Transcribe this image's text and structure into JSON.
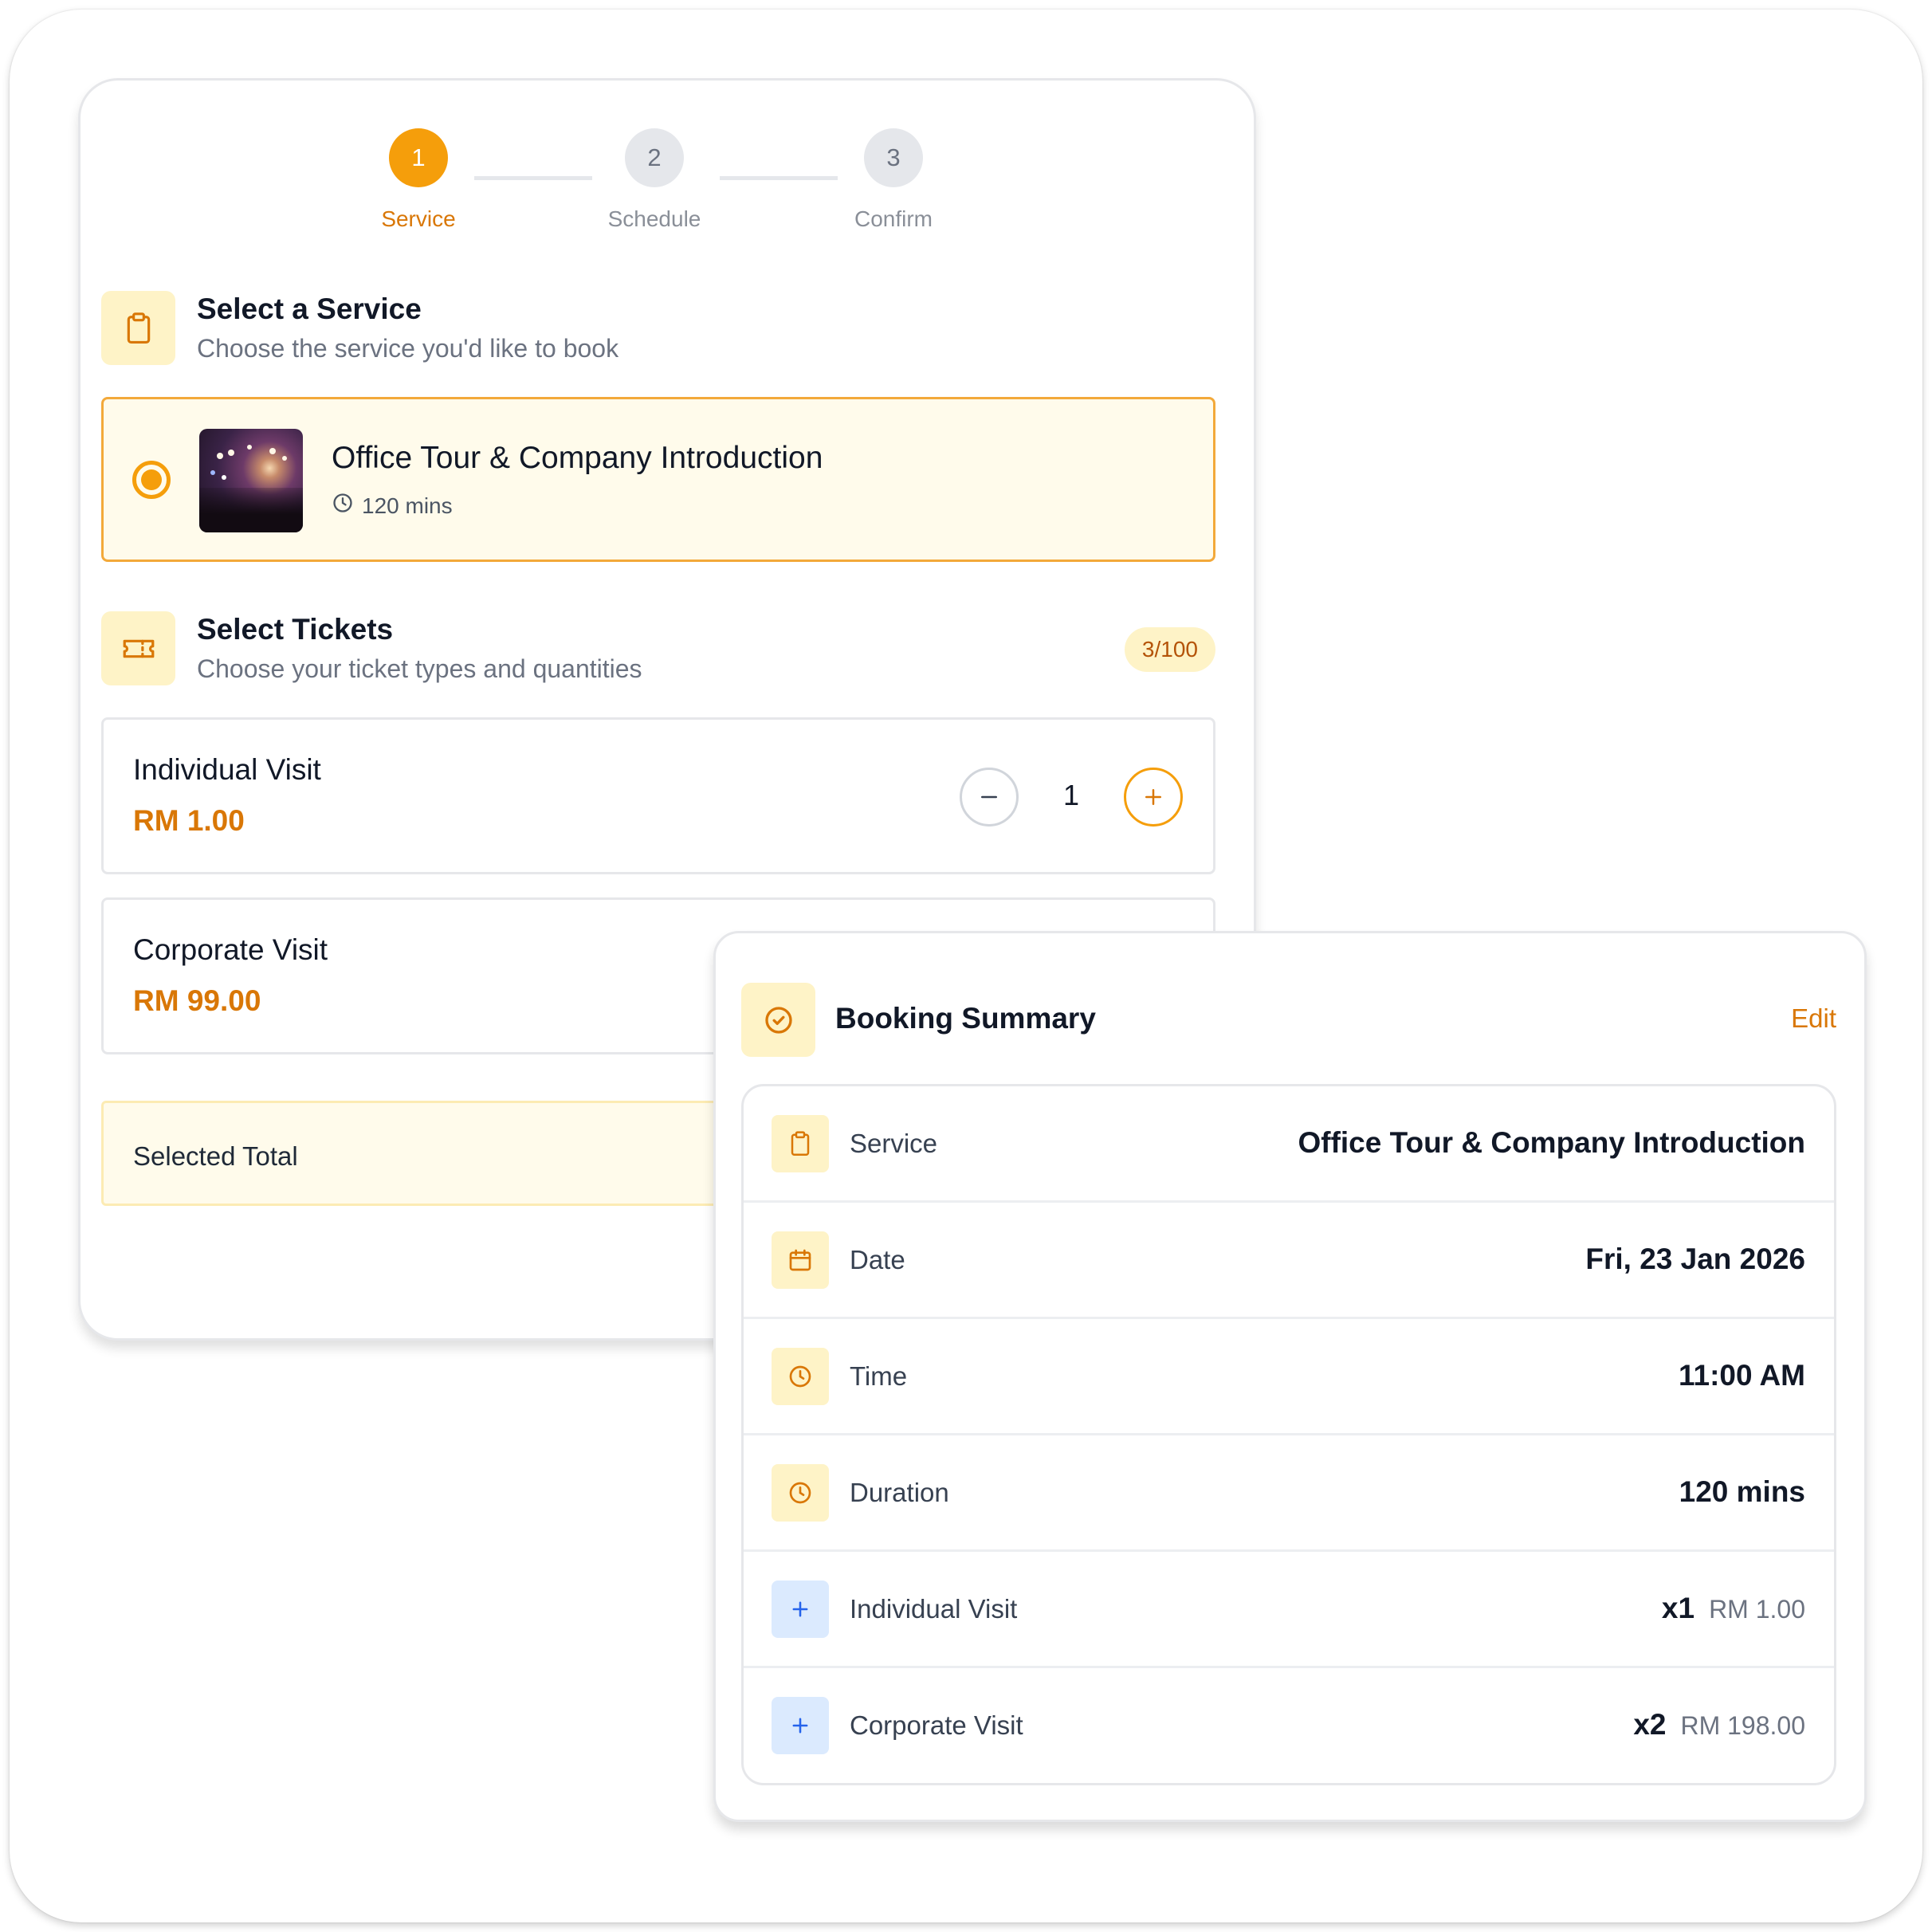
{
  "steps": [
    {
      "number": "1",
      "label": "Service"
    },
    {
      "number": "2",
      "label": "Schedule"
    },
    {
      "number": "3",
      "label": "Confirm"
    }
  ],
  "service_section": {
    "title": "Select a Service",
    "subtitle": "Choose the service you'd like to book",
    "icon": "clipboard-icon"
  },
  "selected_service": {
    "name": "Office Tour & Company Introduction",
    "duration": "120 mins"
  },
  "tickets_section": {
    "title": "Select Tickets",
    "subtitle": "Choose your ticket types and quantities",
    "badge": "3/100",
    "icon": "ticket-icon"
  },
  "tickets": [
    {
      "name": "Individual Visit",
      "price": "RM 1.00",
      "quantity": "1"
    },
    {
      "name": "Corporate Visit",
      "price": "RM 99.00"
    }
  ],
  "total": {
    "label": "Selected Total"
  },
  "summary": {
    "title": "Booking Summary",
    "edit_label": "Edit",
    "rows": [
      {
        "label": "Service",
        "value": "Office Tour & Company Introduction",
        "icon": "clipboard-icon"
      },
      {
        "label": "Date",
        "value": "Fri, 23 Jan 2026",
        "icon": "calendar-icon"
      },
      {
        "label": "Time",
        "value": "11:00 AM",
        "icon": "clock-icon"
      },
      {
        "label": "Duration",
        "value": "120 mins",
        "icon": "clock-icon"
      }
    ],
    "ticket_rows": [
      {
        "label": "Individual Visit",
        "qty": "x1",
        "amount": "RM 1.00",
        "icon": "plus-icon"
      },
      {
        "label": "Corporate Visit",
        "qty": "x2",
        "amount": "RM 198.00",
        "icon": "plus-icon"
      }
    ]
  },
  "colors": {
    "accent": "#f59e0b",
    "accent_text": "#d97706",
    "accent_bg": "#fef3c7",
    "blue_bg": "#dbeafe",
    "blue": "#2563eb"
  }
}
